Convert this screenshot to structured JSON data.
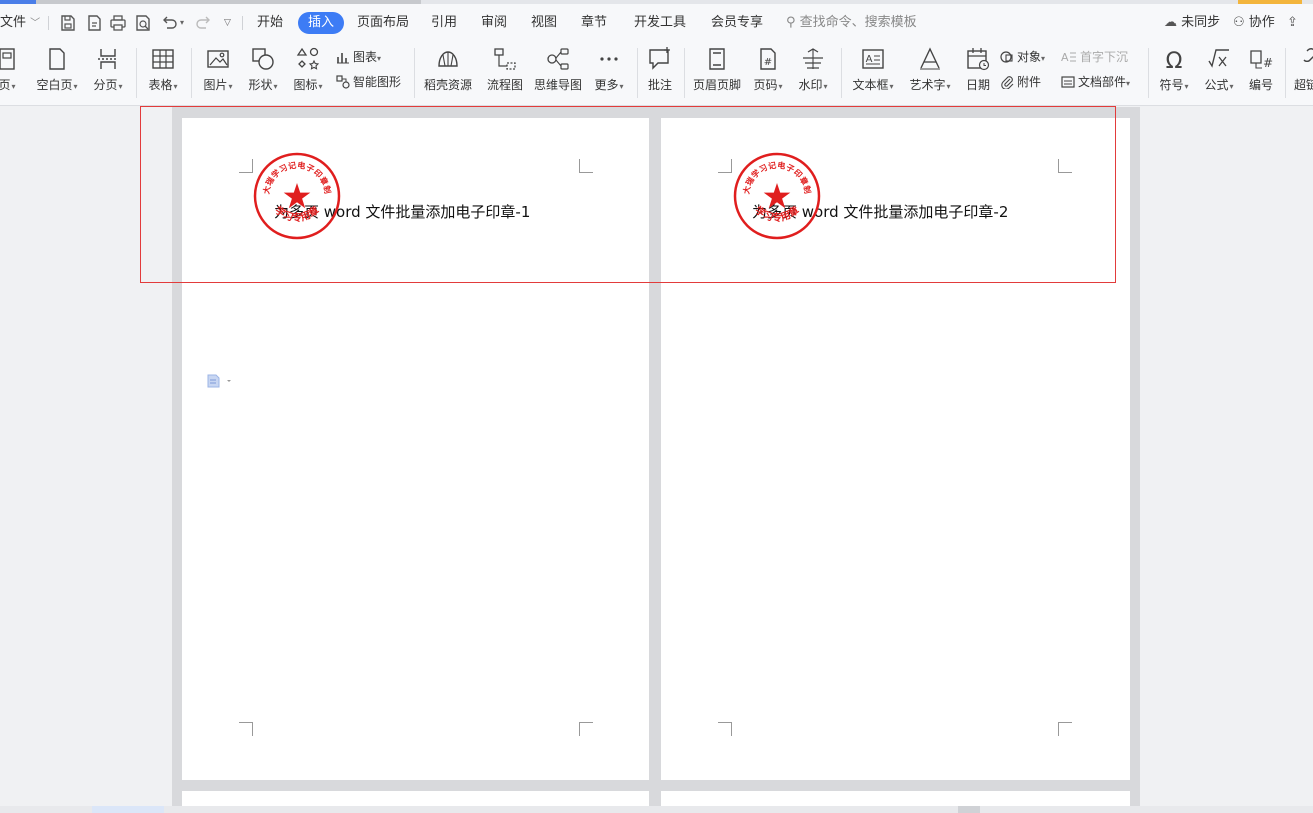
{
  "menu": {
    "file": "文件",
    "tabs": [
      "开始",
      "插入",
      "页面布局",
      "引用",
      "审阅",
      "视图",
      "章节",
      "开发工具",
      "会员专享"
    ],
    "active_tab": "插入",
    "search_placeholder": "查找命令、搜索模板",
    "unsynced": "未同步",
    "collaborate": "协作"
  },
  "ribbon": {
    "cover_page": "页",
    "blank_page": "空白页",
    "page_break": "分页",
    "table": "表格",
    "picture": "图片",
    "shape": "形状",
    "icon": "图标",
    "chart": "图表",
    "smart_art": "智能图形",
    "docer_resources": "稻壳资源",
    "flowchart": "流程图",
    "mind_map": "思维导图",
    "more": "更多",
    "comment": "批注",
    "header_footer": "页眉页脚",
    "page_number": "页码",
    "watermark": "水印",
    "textbox": "文本框",
    "wordart": "艺术字",
    "date": "日期",
    "object": "对象",
    "attachment": "附件",
    "drop_cap": "首字下沉",
    "doc_parts": "文档部件",
    "symbol": "符号",
    "formula": "公式",
    "numbering": "编号",
    "hyperlink": "超链"
  },
  "document": {
    "pages": [
      {
        "title": "为多页 word 文件批量添加电子印章-1"
      },
      {
        "title": "为多页 word 文件批量添加电子印章-2"
      }
    ],
    "stamp": {
      "top_text": "桃大瑞学习记电子印章制作",
      "bottom_text": "学习专用章",
      "color": "#e01e1e"
    }
  },
  "colors": {
    "accent": "#3d7cf5",
    "selection": "#e23b3b"
  }
}
